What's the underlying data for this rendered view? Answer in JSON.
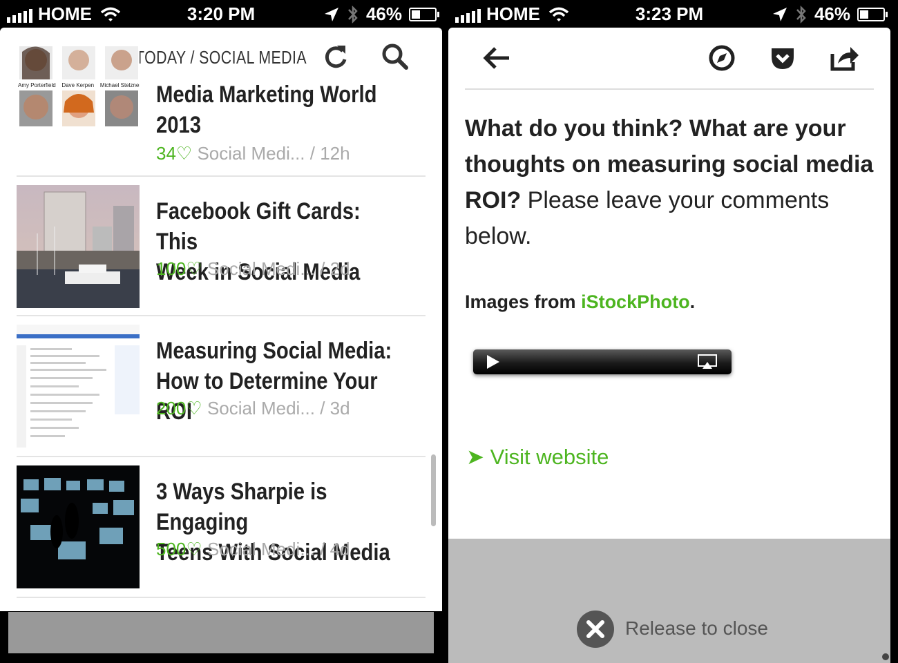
{
  "left": {
    "status": {
      "carrier": "HOME",
      "time": "3:20 PM",
      "battery": "46%"
    },
    "nav": {
      "title": "TODAY / SOCIAL MEDIA"
    },
    "items": [
      {
        "title_lines": [
          "Media Marketing World",
          "2013"
        ],
        "likes": "34",
        "source": "Social Medi... / 12h",
        "thumb_names": [
          "Amy Porterfield",
          "Dave Kerpen",
          "Michael Stelzner"
        ]
      },
      {
        "title_lines": [
          "Facebook Gift Cards: This",
          "Week in Social Media"
        ],
        "likes": "100",
        "source": "Social Medi... / 2d"
      },
      {
        "title_lines": [
          "Measuring Social Media:",
          "How to Determine Your ROI"
        ],
        "likes": "200",
        "source": "Social Medi... / 3d"
      },
      {
        "title_lines": [
          "3 Ways Sharpie is Engaging",
          "Teens With Social Media"
        ],
        "likes": "500",
        "source": "Social Medi... / 4d"
      }
    ]
  },
  "right": {
    "status": {
      "carrier": "HOME",
      "time": "3:23 PM",
      "battery": "46%"
    },
    "article": {
      "bold_text": "What do you think? What are your thoughts on measuring social media ROI?",
      "normal_text": " Please leave your comments below.",
      "credit_prefix": "Images from ",
      "credit_link": "iStockPhoto",
      "credit_suffix": "."
    },
    "visit_label": "Visit website",
    "release_label": "Release to close"
  },
  "colors": {
    "accent": "#4db520",
    "text": "#222222",
    "meta": "#aaaaaa"
  }
}
